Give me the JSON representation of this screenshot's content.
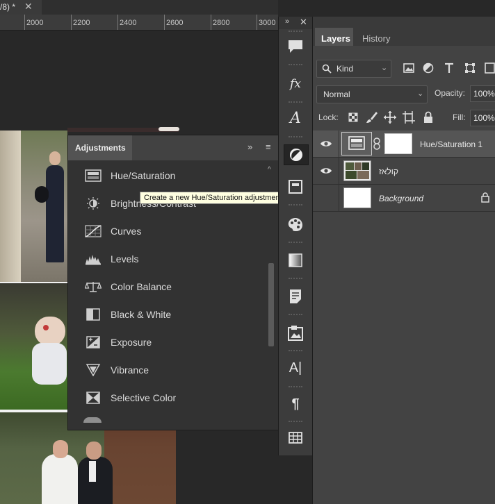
{
  "document": {
    "tab_title": "/8) *",
    "close_glyph": "✕"
  },
  "ruler": {
    "ticks": [
      "2000",
      "2200",
      "2400",
      "2600",
      "2800",
      "3000"
    ]
  },
  "adjustments": {
    "title": "Adjustments",
    "collapse_glyph": "»",
    "menu_glyph": "≡",
    "items": [
      {
        "label": "Hue/Saturation",
        "icon": "hue-saturation-icon"
      },
      {
        "label": "Brightness/Contrast",
        "icon": "brightness-contrast-icon"
      },
      {
        "label": "Curves",
        "icon": "curves-icon"
      },
      {
        "label": "Levels",
        "icon": "levels-icon"
      },
      {
        "label": "Color Balance",
        "icon": "color-balance-icon"
      },
      {
        "label": "Black & White",
        "icon": "black-white-icon"
      },
      {
        "label": "Exposure",
        "icon": "exposure-icon"
      },
      {
        "label": "Vibrance",
        "icon": "vibrance-icon"
      },
      {
        "label": "Selective Color",
        "icon": "selective-color-icon"
      }
    ]
  },
  "tooltip": {
    "text": "Create a new Hue/Saturation adjustment layer"
  },
  "toolstrip": {
    "expand_glyph": "»",
    "close_glyph": "✕",
    "tools": [
      {
        "name": "comments-icon"
      },
      {
        "name": "fx-styles-icon",
        "glyph": "fx"
      },
      {
        "name": "glyphs-icon",
        "glyph": "A"
      },
      {
        "name": "adjustments-icon"
      },
      {
        "name": "properties-icon"
      },
      {
        "name": "swatches-palette-icon"
      },
      {
        "name": "gradients-icon"
      },
      {
        "name": "notes-icon"
      },
      {
        "name": "image-library-icon"
      },
      {
        "name": "character-icon",
        "glyph": "A|"
      },
      {
        "name": "paragraph-icon",
        "glyph": "¶"
      },
      {
        "name": "table-grid-icon"
      }
    ]
  },
  "layers_panel": {
    "tabs": [
      {
        "label": "Layers",
        "active": true
      },
      {
        "label": "History",
        "active": false
      }
    ],
    "filter": {
      "label": "Kind"
    },
    "blend_mode": "Normal",
    "opacity_label": "Opacity:",
    "opacity_value": "100%",
    "lock_label": "Lock:",
    "fill_label": "Fill:",
    "fill_value": "100%",
    "layers": [
      {
        "name": "Hue/Saturation 1",
        "type": "adjustment",
        "visible": true,
        "selected": true
      },
      {
        "name": "קולאז",
        "type": "smart-object",
        "visible": true,
        "selected": false
      },
      {
        "name": "Background",
        "type": "background",
        "visible": false,
        "selected": false,
        "locked": true
      }
    ]
  },
  "colors": {
    "panel_bg": "#434343",
    "panel_dark": "#323232",
    "tooltip_bg": "#ffffe1",
    "selected_layer": "#555555"
  }
}
